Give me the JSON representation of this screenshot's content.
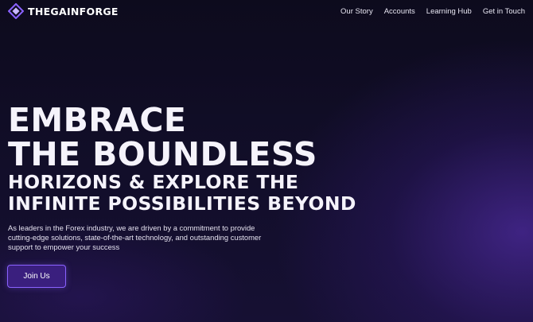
{
  "brand": {
    "name": "THEGAINFORGE",
    "logo_icon": "diamond-logo-icon",
    "accent": "#8a62ff"
  },
  "nav": {
    "links": [
      "Our Story",
      "Accounts",
      "Learning Hub",
      "Get in Touch"
    ]
  },
  "hero": {
    "headline_lines": [
      "EMBRACE",
      "THE BOUNDLESS",
      "HORIZONS & EXPLORE THE",
      "INFINITE POSSIBILITIES BEYOND"
    ],
    "subtext_lines": [
      "As leaders in the Forex industry, we are driven by a commitment to provide",
      "cutting-edge solutions, state-of-the-art technology, and outstanding customer",
      "support to empower your success"
    ],
    "cta_label": "Join Us"
  }
}
